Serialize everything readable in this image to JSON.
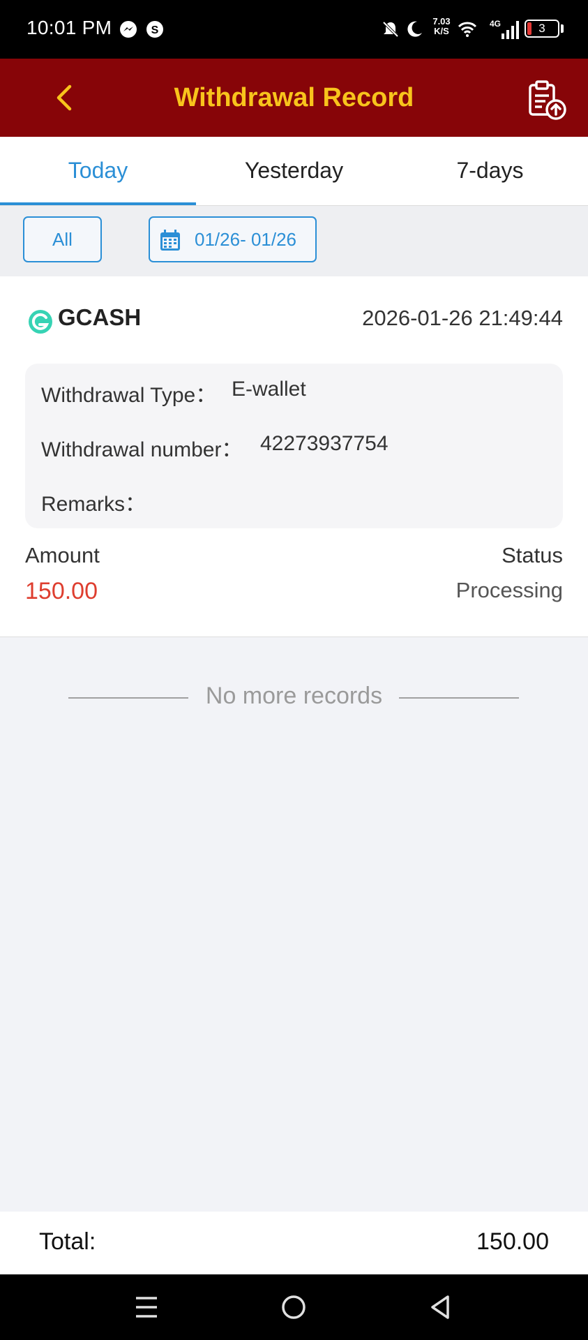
{
  "status_bar": {
    "time": "10:01 PM",
    "net_speed_value": "7.03",
    "net_speed_unit": "K/S",
    "network": "4G",
    "battery": "3",
    "icons": [
      "messenger-icon",
      "s-app-icon",
      "mute-icon",
      "moon-icon",
      "wifi-icon",
      "signal-icon",
      "battery-icon"
    ],
    "battery_color": "#e53935"
  },
  "header": {
    "title": "Withdrawal Record",
    "back_icon": "chevron-left-icon",
    "action_icon": "clipboard-upload-icon",
    "background_color": "#870508",
    "title_color": "#f8c41c"
  },
  "tabs": {
    "items": [
      {
        "label": "Today",
        "active": true
      },
      {
        "label": "Yesterday",
        "active": false
      },
      {
        "label": "7-days",
        "active": false
      }
    ],
    "accent_color": "#2b8fd6"
  },
  "filters": {
    "type_label": "All",
    "date_range": "01/26- 01/26",
    "date_icon": "calendar-icon"
  },
  "records": [
    {
      "method": "GCASH",
      "method_icon": "gcash-logo-icon",
      "datetime": "2026-01-26 21:49:44",
      "type_label": "Withdrawal Type：",
      "type_value": "E-wallet",
      "number_label": "Withdrawal number：",
      "number_value": "42273937754",
      "remarks_label": "Remarks：",
      "remarks_value": "",
      "amount_label": "Amount",
      "amount_value": "150.00",
      "status_label": "Status",
      "status_value": "Processing",
      "amount_color": "#de3e2f"
    }
  ],
  "footer_message": "No more records",
  "total": {
    "label": "Total:",
    "value": "150.00"
  },
  "system_nav": {
    "icons": [
      "menu-icon",
      "home-icon",
      "back-icon"
    ]
  }
}
